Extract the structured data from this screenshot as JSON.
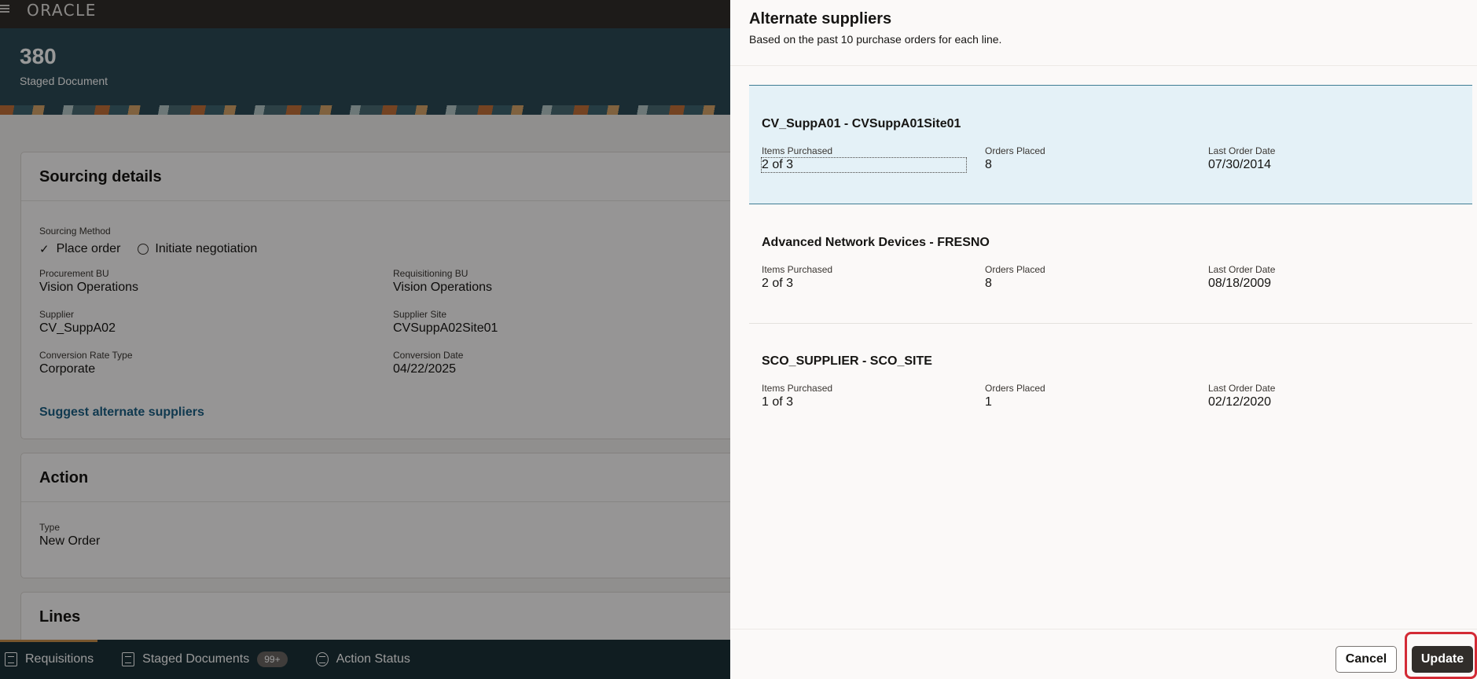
{
  "app": {
    "logo": "ORACLE"
  },
  "header": {
    "doc_number": "380",
    "doc_label": "Staged Document"
  },
  "sourcing": {
    "title": "Sourcing details",
    "method_label": "Sourcing Method",
    "method_selected": "Place order",
    "method_other": "Initiate negotiation",
    "fields": [
      {
        "label": "Procurement BU",
        "value": "Vision Operations"
      },
      {
        "label": "Requisitioning BU",
        "value": "Vision Operations"
      },
      {
        "label": "Supplier",
        "value": "CV_SuppA02"
      },
      {
        "label": "Supplier Site",
        "value": "CVSuppA02Site01"
      },
      {
        "label": "Conversion Rate Type",
        "value": "Corporate"
      },
      {
        "label": "Conversion Date",
        "value": "04/22/2025"
      }
    ],
    "suggest_link": "Suggest alternate suppliers"
  },
  "action": {
    "title": "Action",
    "type_label": "Type",
    "type_value": "New Order"
  },
  "lines": {
    "title": "Lines"
  },
  "bottom_nav": [
    {
      "label": "Requisitions"
    },
    {
      "label": "Staged Documents",
      "badge": "99+"
    },
    {
      "label": "Action Status"
    }
  ],
  "drawer": {
    "title": "Alternate suppliers",
    "subtitle": "Based on the past 10 purchase orders for each line.",
    "col_labels": {
      "items": "Items Purchased",
      "orders": "Orders Placed",
      "date": "Last Order Date"
    },
    "suppliers": [
      {
        "name": "CV_SuppA01 - CVSuppA01Site01",
        "items": "2 of 3",
        "orders": "8",
        "date": "07/30/2014"
      },
      {
        "name": "Advanced Network Devices - FRESNO",
        "items": "2 of 3",
        "orders": "8",
        "date": "08/18/2009"
      },
      {
        "name": "SCO_SUPPLIER - SCO_SITE",
        "items": "1 of 3",
        "orders": "1",
        "date": "02/12/2020"
      }
    ],
    "cancel_label": "Cancel",
    "update_label": "Update"
  },
  "colors": {
    "header": "#2c4a55",
    "selected_row": "#e4f1f7",
    "link": "#1b5f84",
    "highlight": "#d32a35"
  }
}
